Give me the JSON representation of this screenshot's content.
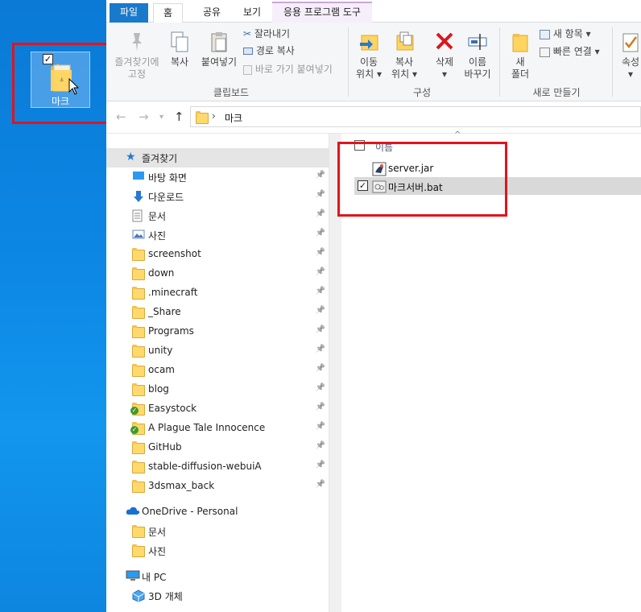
{
  "desktop": {
    "icon_label": "마크"
  },
  "ribbon": {
    "tabs": {
      "file": "파일",
      "home": "홈",
      "share": "공유",
      "view": "보기",
      "app_tools": "응용 프로그램 도구"
    },
    "clipboard": {
      "pin_line1": "즐겨찾기에",
      "pin_line2": "고정",
      "copy": "복사",
      "paste": "붙여넣기",
      "cut": "잘라내기",
      "copy_path": "경로 복사",
      "paste_shortcut": "바로 가기 붙여넣기",
      "group": "클립보드"
    },
    "organize": {
      "move_line1": "이동",
      "move_line2": "위치",
      "copy_line1": "복사",
      "copy_line2": "위치",
      "delete": "삭제",
      "rename_line1": "이름",
      "rename_line2": "바꾸기",
      "group": "구성"
    },
    "new": {
      "new_folder_line1": "새",
      "new_folder_line2": "폴더",
      "new_item": "새 항목",
      "easy_access": "빠른 연결",
      "group": "새로 만들기"
    },
    "open": {
      "properties": "속성"
    }
  },
  "address": {
    "path": "마크"
  },
  "nav": {
    "quick_access": "즐겨찾기",
    "items": [
      {
        "label": "바탕 화면",
        "icon": "desktop-icon"
      },
      {
        "label": "다운로드",
        "icon": "download-icon"
      },
      {
        "label": "문서",
        "icon": "document-icon"
      },
      {
        "label": "사진",
        "icon": "pictures-icon"
      },
      {
        "label": "screenshot",
        "icon": "folder-icon"
      },
      {
        "label": "down",
        "icon": "folder-icon"
      },
      {
        "label": ".minecraft",
        "icon": "folder-icon"
      },
      {
        "label": "_Share",
        "icon": "folder-icon"
      },
      {
        "label": "Programs",
        "icon": "folder-icon"
      },
      {
        "label": "unity",
        "icon": "folder-icon"
      },
      {
        "label": "ocam",
        "icon": "folder-icon"
      },
      {
        "label": "blog",
        "icon": "folder-icon"
      },
      {
        "label": "Easystock",
        "icon": "synced-folder-icon"
      },
      {
        "label": "A Plague Tale Innocence",
        "icon": "synced-folder-icon"
      },
      {
        "label": "GitHub",
        "icon": "folder-icon"
      },
      {
        "label": "stable-diffusion-webuiA",
        "icon": "folder-icon"
      },
      {
        "label": "3dsmax_back",
        "icon": "folder-icon"
      }
    ],
    "onedrive": "OneDrive - Personal",
    "onedrive_items": [
      "문서",
      "사진"
    ],
    "this_pc": "내 PC",
    "pc_items": [
      "3D 개체"
    ]
  },
  "content": {
    "column_name": "이름",
    "files": [
      {
        "name": "server.jar",
        "selected": false
      },
      {
        "name": "마크서버.bat",
        "selected": true
      }
    ]
  },
  "colors": {
    "accent": "#1979ca",
    "highlight_box": "#e0141e",
    "desktop_bg": "#0c86e3"
  }
}
